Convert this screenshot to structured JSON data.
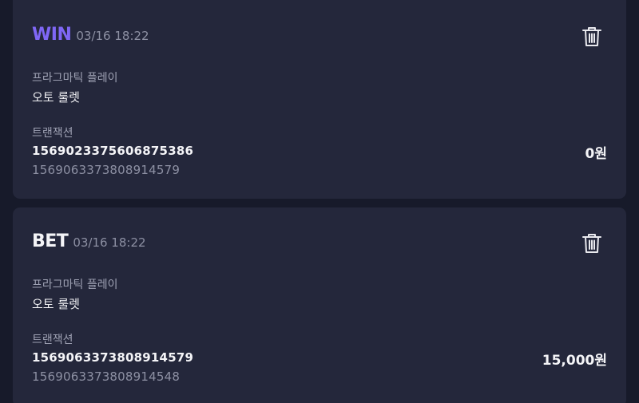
{
  "records": [
    {
      "type": "WIN",
      "time": "03/16 18:22",
      "provider_label": "프라그마틱 플레이",
      "game": "오토 룰렛",
      "transaction_label": "트랜잭션",
      "transaction_id": "1569023375606875386",
      "sub_id": "1569063373808914579",
      "amount": "0원",
      "type_color": "#7f67f5",
      "delete_icon": "trash-icon"
    },
    {
      "type": "BET",
      "time": "03/16 18:22",
      "provider_label": "프라그마틱 플레이",
      "game": "오토 룰렛",
      "transaction_label": "트랜잭션",
      "transaction_id": "1569063373808914579",
      "sub_id": "1569063373808914548",
      "amount": "15,000원",
      "type_color": "#f4f4f7",
      "delete_icon": "trash-icon"
    }
  ]
}
